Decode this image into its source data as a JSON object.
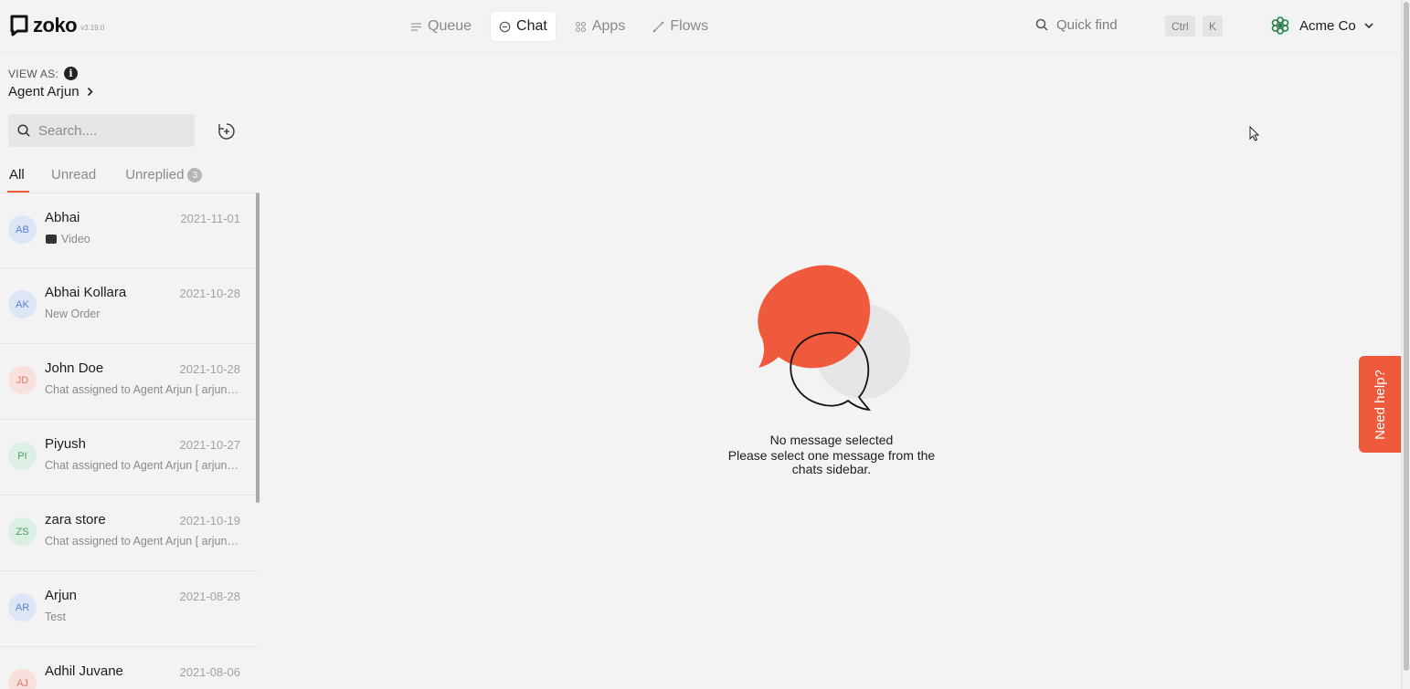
{
  "app": {
    "logo_text": "zoko",
    "version": "v3.19.0"
  },
  "nav": {
    "items": [
      {
        "label": "Queue",
        "icon": "queue-icon"
      },
      {
        "label": "Chat",
        "icon": "chat-icon",
        "active": true
      },
      {
        "label": "Apps",
        "icon": "apps-icon"
      },
      {
        "label": "Flows",
        "icon": "flows-icon"
      }
    ]
  },
  "quickfind": {
    "label": "Quick find",
    "shortcut_ctrl": "Ctrl",
    "shortcut_key": "K"
  },
  "account": {
    "name": "Acme Co"
  },
  "sidebar": {
    "view_as_label": "VIEW AS:",
    "agent_name": "Agent Arjun",
    "search_placeholder": "Search....",
    "tabs": {
      "all": "All",
      "unread": "Unread",
      "unreplied": "Unreplied",
      "unreplied_count": "3"
    },
    "chats": [
      {
        "initials": "AB",
        "name": "Abhai",
        "date": "2021-11-01",
        "preview": "Video",
        "color": "blue",
        "has_video_icon": true
      },
      {
        "initials": "AK",
        "name": "Abhai Kollara",
        "date": "2021-10-28",
        "preview": "New Order",
        "color": "blue"
      },
      {
        "initials": "JD",
        "name": "John Doe",
        "date": "2021-10-28",
        "preview": "Chat assigned to Agent Arjun [ arjun@zoko.io ]",
        "color": "pink"
      },
      {
        "initials": "PI",
        "name": "Piyush",
        "date": "2021-10-27",
        "preview": "Chat assigned to Agent Arjun [ arjun@zoko.io ]",
        "color": "green"
      },
      {
        "initials": "ZS",
        "name": "zara store",
        "date": "2021-10-19",
        "preview": "Chat assigned to Agent Arjun [ arjun@zoko.io ]",
        "color": "green"
      },
      {
        "initials": "AR",
        "name": "Arjun",
        "date": "2021-08-28",
        "preview": "Test",
        "color": "blue"
      },
      {
        "initials": "AJ",
        "name": "Adhil Juvane",
        "date": "2021-08-06",
        "preview": "",
        "color": "pink"
      }
    ]
  },
  "empty_state": {
    "title": "No message selected",
    "subtitle_line1": "Please select one message from the",
    "subtitle_line2": "chats sidebar."
  },
  "help_button": "Need help?",
  "colors": {
    "accent": "#f05a3c",
    "background": "#f3f3f3"
  }
}
